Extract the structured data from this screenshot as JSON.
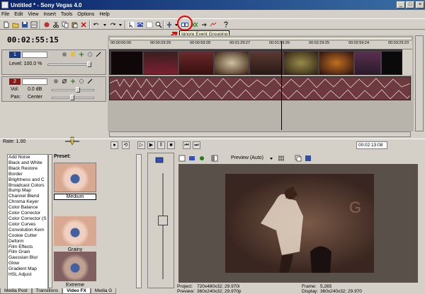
{
  "window": {
    "title": "Untitled * - Sony Vegas 4.0"
  },
  "menu": [
    "File",
    "Edit",
    "View",
    "Insert",
    "Tools",
    "Options",
    "Help"
  ],
  "tooltip": "Ignore Event Grouping",
  "timecode": "00:02:55:15",
  "video_track": {
    "number": "1",
    "level_label": "Level: 100.0 %"
  },
  "audio_track": {
    "number": "2",
    "vol_label": "Vol:",
    "vol_value": "0.0 dB",
    "pan_label": "Pan:",
    "pan_value": "Center"
  },
  "ruler": [
    "00:00:00:00",
    "00:00:29:29",
    "00:00:59:28",
    "00:01:29:27",
    "00:01:59:26",
    "00:02:29:25",
    "00:02:59:24",
    "00:03:29:23"
  ],
  "rate": "Rate: 1.00",
  "transport_time": "00:02:13:08",
  "fx_list": [
    "Add Noise",
    "Black and White",
    "Black Restore",
    "Border",
    "Brightness and C",
    "Broadcast Colors",
    "Bump Map",
    "Channel Blend",
    "Chroma Keyer",
    "Color Balance",
    "Color Corrector",
    "Color Corrector (S",
    "Color Curves",
    "Convolution Kern",
    "Cookie Cutter",
    "Deform",
    "Film Effects",
    "Film Grain",
    "Gaussian Blur",
    "Glow",
    "Gradient Map",
    "HSL Adjust"
  ],
  "preset": {
    "header": "Preset:",
    "items": [
      "Medium",
      "Grainy",
      "Extreme"
    ]
  },
  "tabs": [
    "Media Pool",
    "Transitions",
    "Video FX",
    "Media G"
  ],
  "preview": {
    "mode": "Preview (Auto)"
  },
  "status": {
    "project_label": "Project:",
    "project_value": "720x480x32; 29.970i",
    "frame_label": "Frame:",
    "frame_value": "5,265",
    "preview_label": "Preview:",
    "preview_value": "360x240x32; 29.970p",
    "display_label": "Display:",
    "display_value": "360x240x32; 29.970"
  },
  "colors": {
    "titlebar": "#0a246a",
    "track_header": "#1a3a8a",
    "audio": "#6d3a40",
    "highlight": "#e00000"
  }
}
